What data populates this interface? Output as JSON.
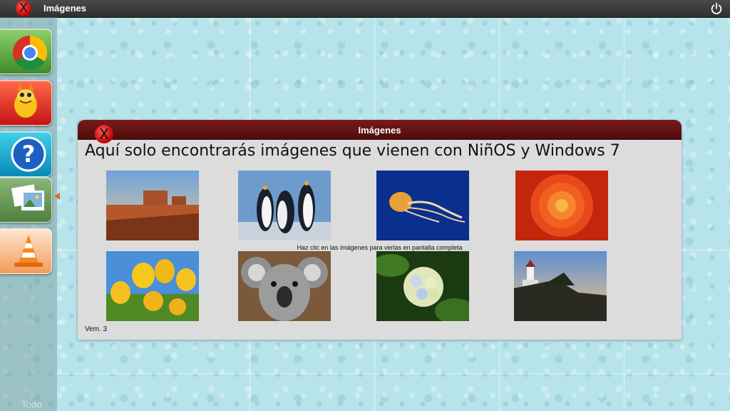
{
  "window": {
    "title": "Imágenes"
  },
  "topbar": {
    "close_icon": "x-close-icon",
    "power_icon": "power-icon"
  },
  "sidebar": {
    "items": [
      {
        "name": "chrome",
        "icon": "chrome-icon"
      },
      {
        "name": "dragon-game",
        "icon": "dragon-icon"
      },
      {
        "name": "help",
        "icon": "question-icon"
      },
      {
        "name": "photos",
        "icon": "photos-icon"
      },
      {
        "name": "vlc",
        "icon": "vlc-cone-icon"
      }
    ],
    "bottom_label": "Todo"
  },
  "dialog": {
    "title": "Imágenes",
    "heading": "Aquí solo encontrarás imágenes que vienen con NiñOS y Windows 7",
    "hint": "Haz clic en las imágenes para verlas en pantalla completa",
    "version": "Vem. 3",
    "images": [
      "desert",
      "penguins",
      "jellyfish",
      "chrysanthemum",
      "tulips",
      "koala",
      "hydrangeas",
      "lighthouse"
    ]
  }
}
